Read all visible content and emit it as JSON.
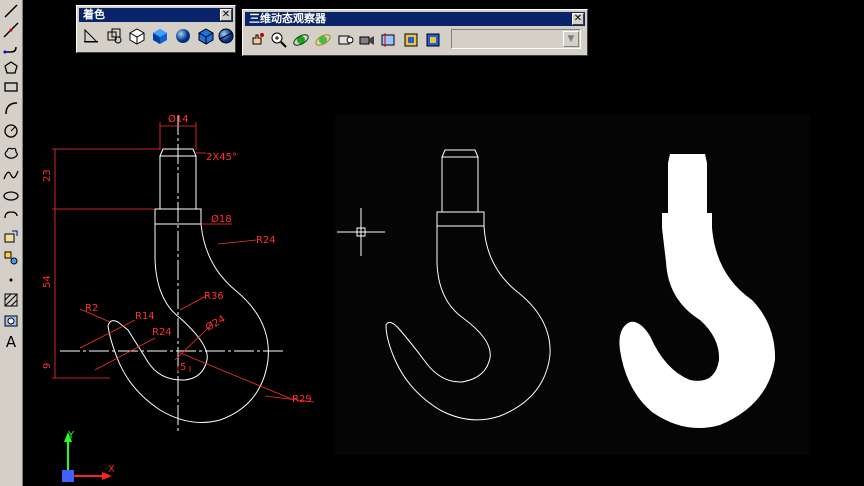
{
  "shading_toolbar": {
    "title": "着色",
    "close": "✕"
  },
  "orbit_toolbar": {
    "title": "三维动态观察器",
    "close": "✕",
    "view_dropdown_value": ""
  },
  "left_toolbar": {
    "text_tool_label": "A"
  },
  "dimensions": {
    "d14": "Ø14",
    "chamfer": "2X45°",
    "h23": "23",
    "d18": "Ø18",
    "r24_top": "R24",
    "h54": "54",
    "r36": "R36",
    "r2": "R2",
    "r14": "R14",
    "r24_low": "R24",
    "d24": "Ø24",
    "h9": "9",
    "dist5": "5",
    "r29": "R29"
  },
  "ucs": {
    "x_label": "X",
    "y_label": "Y"
  },
  "colors": {
    "panel_title": "#0a246a",
    "dimension": "#ff3030",
    "geometry": "#ffffff",
    "ucs_x": "#ff2020",
    "ucs_y": "#20ff20",
    "ucs_z": "#4060ff"
  }
}
